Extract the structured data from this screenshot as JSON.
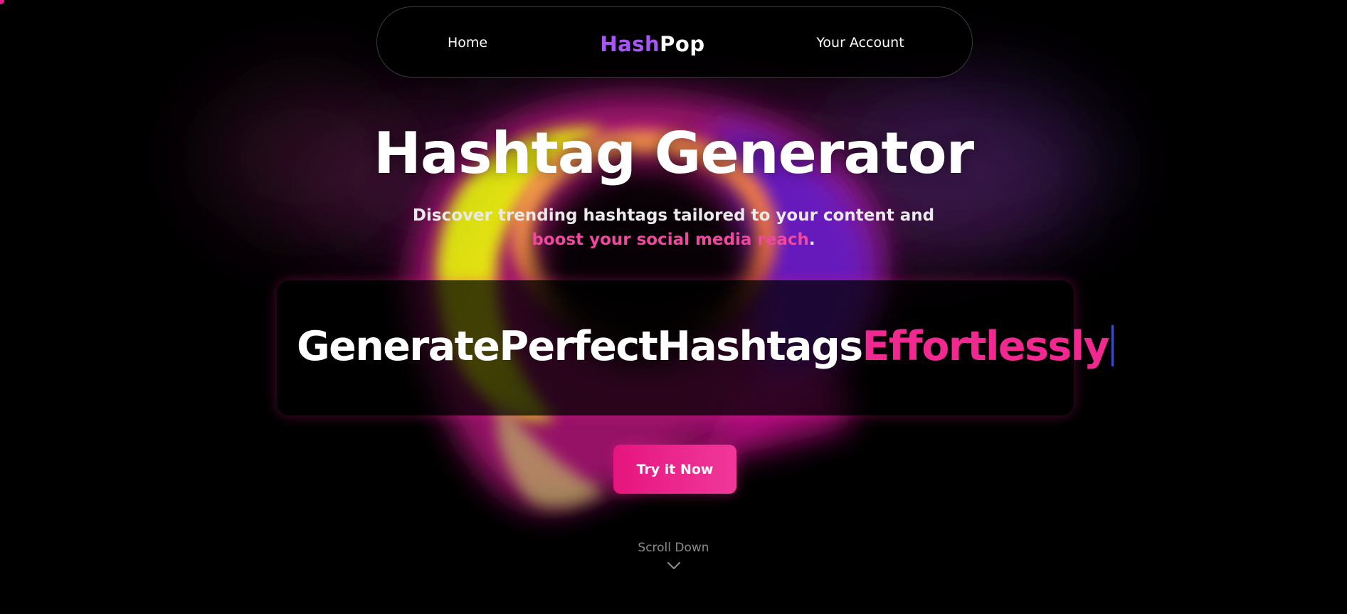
{
  "nav": {
    "home_label": "Home",
    "logo_part1": "Hash",
    "logo_part2": "Pop",
    "account_label": "Your Account"
  },
  "hero": {
    "title": "Hashtag Generator",
    "subtitle_plain": "Discover trending hashtags tailored to your content and",
    "subtitle_accent": "boost your social media reach",
    "subtitle_end": "."
  },
  "typing": {
    "text_plain": "GeneratePerfectHashtags",
    "text_accent": "Effortlessly"
  },
  "cta": {
    "label": "Try it Now"
  },
  "scroll": {
    "label": "Scroll Down",
    "icon": "chevron-down-icon"
  },
  "colors": {
    "background": "#000000",
    "logo_hash": "#a855f7",
    "accent_pink": "#f0288f",
    "caret": "#3b4fc4"
  }
}
